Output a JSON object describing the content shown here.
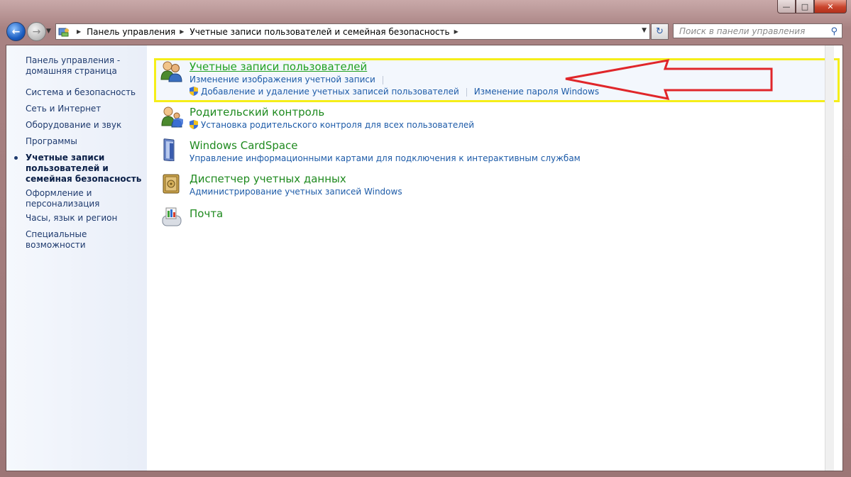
{
  "window": {
    "minimize_icon": "minimize-icon",
    "maximize_icon": "maximize-icon",
    "close_icon": "close-icon"
  },
  "address": {
    "root": "Панель управления",
    "current": "Учетные записи пользователей и семейная безопасность"
  },
  "search": {
    "placeholder": "Поиск в панели управления"
  },
  "sidebar": {
    "home": "Панель управления - домашняя страница",
    "items": [
      "Система и безопасность",
      "Сеть и Интернет",
      "Оборудование и звук",
      "Программы",
      "Учетные записи пользователей и семейная безопасность",
      "Оформление и персонализация",
      "Часы, язык и регион",
      "Специальные возможности"
    ]
  },
  "categories": [
    {
      "title": "Учетные записи пользователей",
      "links": [
        "Изменение изображения учетной записи",
        "Добавление и удаление учетных записей пользователей",
        "Изменение пароля Windows"
      ]
    },
    {
      "title": "Родительский контроль",
      "links": [
        "Установка родительского контроля для всех пользователей"
      ]
    },
    {
      "title": "Windows CardSpace",
      "links": [
        "Управление информационными картами для подключения к интерактивным службам"
      ]
    },
    {
      "title": "Диспетчер учетных данных",
      "links": [
        "Администрирование учетных записей Windows"
      ]
    },
    {
      "title": "Почта",
      "links": []
    }
  ],
  "colors": {
    "highlight_box": "#f5ee19",
    "annotation_arrow": "#e0262a",
    "category_title": "#1f8a1f",
    "link": "#1d5ba8"
  }
}
